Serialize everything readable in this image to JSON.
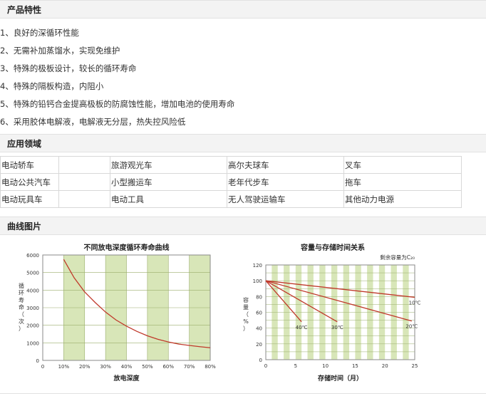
{
  "features": {
    "heading": "产品特性",
    "items": [
      "1、良好的深循环性能",
      "2、无需补加蒸馏水，实现免维护",
      "3、特殊的极板设计，较长的循环寿命",
      "4、特殊的隔板构造，内阻小",
      "5、特殊的铅钙合金提高极板的防腐蚀性能，增加电池的使用寿命",
      "6、采用胶体电解液，电解液无分层，热失控风险低"
    ]
  },
  "applications": {
    "heading": "应用领域",
    "rows": [
      [
        "电动轿车",
        "",
        "旅游观光车",
        "高尔夫球车",
        "叉车"
      ],
      [
        "电动公共汽车",
        "",
        "小型搬运车",
        "老年代步车",
        "拖车"
      ],
      [
        "电动玩具车",
        "",
        "电动工具",
        "无人驾驶运输车",
        "其他动力电源"
      ]
    ]
  },
  "curves": {
    "heading": "曲线图片"
  },
  "colors": {
    "band": "#d8e6b8",
    "curve": "#c0392b",
    "grid": "#9aae6c",
    "frame": "#8a8a8a"
  },
  "chart_data": [
    {
      "type": "line",
      "title": "不同放电深度循环寿命曲线",
      "xlabel": "放电深度",
      "ylabel": "循环寿命（次）",
      "x_ticks": [
        "0",
        "10%",
        "20%",
        "30%",
        "40%",
        "50%",
        "60%",
        "70%",
        "80%"
      ],
      "y_ticks": [
        "0",
        "1000",
        "2000",
        "3000",
        "4000",
        "5000",
        "6000"
      ],
      "xlim": [
        0,
        80
      ],
      "ylim": [
        0,
        6000
      ],
      "grid": true,
      "series": [
        {
          "x": [
            10,
            15,
            20,
            25,
            30,
            35,
            40,
            45,
            50,
            55,
            60,
            65,
            70,
            75,
            80
          ],
          "y": [
            5750,
            4700,
            3900,
            3300,
            2750,
            2300,
            1950,
            1650,
            1400,
            1200,
            1050,
            930,
            850,
            780,
            720
          ]
        }
      ]
    },
    {
      "type": "line",
      "title": "容量与存储时间关系",
      "xlabel": "存储时间（月）",
      "ylabel": "容量（%）",
      "legend_note": "剩余容量为C₂₀",
      "x_ticks": [
        "0",
        "5",
        "10",
        "15",
        "20",
        "25"
      ],
      "y_ticks": [
        "0",
        "20",
        "40",
        "60",
        "80",
        "100",
        "120"
      ],
      "xlim": [
        0,
        25
      ],
      "ylim": [
        0,
        120
      ],
      "grid": true,
      "series": [
        {
          "name": "10℃",
          "x": [
            0,
            25
          ],
          "y": [
            100,
            79
          ]
        },
        {
          "name": "20℃",
          "x": [
            0,
            24.5
          ],
          "y": [
            100,
            49
          ]
        },
        {
          "name": "30℃",
          "x": [
            0,
            12
          ],
          "y": [
            100,
            48
          ]
        },
        {
          "name": "40℃",
          "x": [
            0,
            6
          ],
          "y": [
            100,
            48
          ]
        }
      ]
    }
  ]
}
